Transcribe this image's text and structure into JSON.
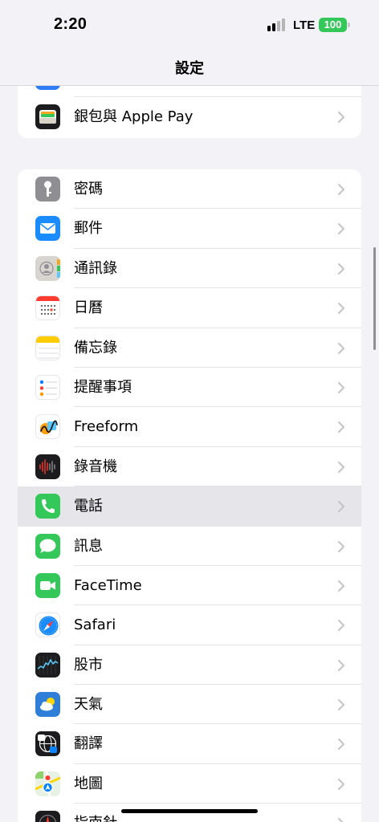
{
  "status_bar": {
    "time": "2:20",
    "network": "LTE",
    "battery": "100",
    "battery_color": "#34c759"
  },
  "nav": {
    "title": "設定"
  },
  "groups": [
    {
      "items": [
        {
          "label": "",
          "icon": "partial-icon"
        },
        {
          "label": "銀包與 Apple Pay",
          "icon": "wallet-icon"
        }
      ]
    },
    {
      "items": [
        {
          "label": "密碼",
          "icon": "key-icon"
        },
        {
          "label": "郵件",
          "icon": "mail-icon"
        },
        {
          "label": "通訊錄",
          "icon": "contacts-icon"
        },
        {
          "label": "日曆",
          "icon": "calendar-icon"
        },
        {
          "label": "備忘錄",
          "icon": "notes-icon"
        },
        {
          "label": "提醒事項",
          "icon": "reminders-icon"
        },
        {
          "label": "Freeform",
          "icon": "freeform-icon"
        },
        {
          "label": "錄音機",
          "icon": "voice-memos-icon"
        },
        {
          "label": "電話",
          "icon": "phone-icon",
          "highlighted": true
        },
        {
          "label": "訊息",
          "icon": "messages-icon"
        },
        {
          "label": "FaceTime",
          "icon": "facetime-icon"
        },
        {
          "label": "Safari",
          "icon": "safari-icon"
        },
        {
          "label": "股市",
          "icon": "stocks-icon"
        },
        {
          "label": "天氣",
          "icon": "weather-icon"
        },
        {
          "label": "翻譯",
          "icon": "translate-icon"
        },
        {
          "label": "地圖",
          "icon": "maps-icon"
        },
        {
          "label": "指南針",
          "icon": "compass-icon"
        }
      ]
    }
  ]
}
